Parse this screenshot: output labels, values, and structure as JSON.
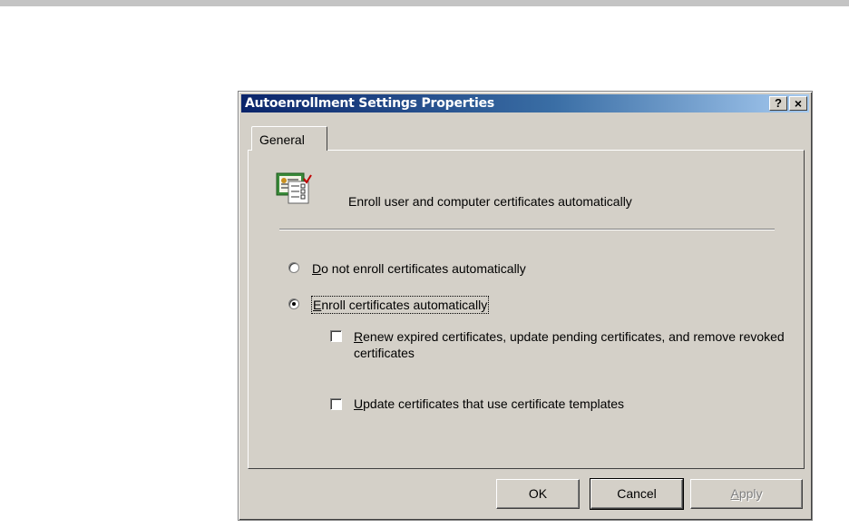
{
  "window": {
    "title": "Autoenrollment Settings Properties",
    "help_glyph": "?",
    "close_glyph": "×"
  },
  "tabs": [
    {
      "label": "General"
    }
  ],
  "panel": {
    "heading": "Enroll user and computer certificates automatically",
    "icon": "certificate-icon",
    "radio_options": [
      {
        "mnemonic": "D",
        "rest": "o not enroll certificates automatically",
        "selected": false
      },
      {
        "mnemonic": "E",
        "rest": "nroll certificates automatically",
        "selected": true
      }
    ],
    "checkboxes": [
      {
        "mnemonic": "R",
        "rest": "enew expired certificates, update pending certificates, and remove revoked certificates",
        "checked": false
      },
      {
        "mnemonic": "U",
        "rest": "pdate certificates that use certificate templates",
        "checked": false
      }
    ]
  },
  "buttons": {
    "ok": "OK",
    "cancel": "Cancel",
    "apply_mnemonic": "A",
    "apply_rest": "pply"
  },
  "colors": {
    "dialog_bg": "#d4d0c8",
    "title_start": "#0a246a",
    "title_end": "#a6caf0"
  }
}
